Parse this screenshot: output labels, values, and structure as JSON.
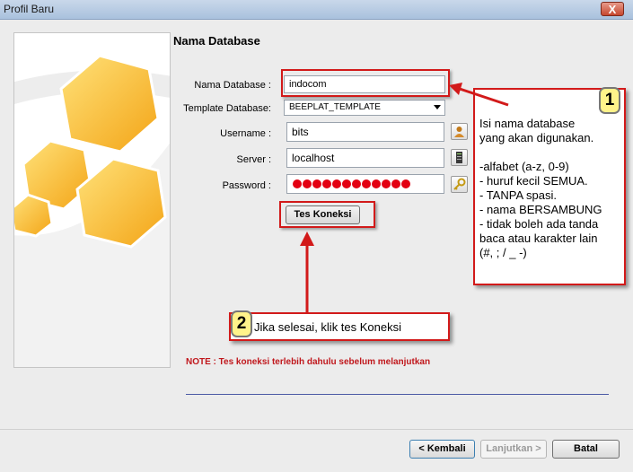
{
  "window": {
    "title": "Profil Baru",
    "close_glyph": "X"
  },
  "page": {
    "heading": "Nama Database"
  },
  "form": {
    "db_name": {
      "label": "Nama Database :",
      "value": "indocom"
    },
    "template": {
      "label": "Template Database:",
      "value": "BEEPLAT_TEMPLATE"
    },
    "username": {
      "label": "Username :",
      "value": "bits"
    },
    "server": {
      "label": "Server :",
      "value": "localhost"
    },
    "password": {
      "label": "Password :",
      "masked_length": 12
    },
    "test_button": "Tes Koneksi"
  },
  "note": "NOTE : Tes koneksi terlebih dahulu sebelum melanjutkan",
  "nav": {
    "back": "< Kembali",
    "next": "Lanjutkan >",
    "cancel": "Batal"
  },
  "callout1": {
    "number": "1",
    "lines": [
      "Isi nama database",
      "yang akan digunakan.",
      "",
      "-alfabet (a-z, 0-9)",
      "- huruf kecil SEMUA.",
      "- TANPA spasi.",
      "- nama BERSAMBUNG",
      "- tidak boleh ada tanda",
      "baca atau karakter lain",
      "(#, ; / _ -)"
    ]
  },
  "callout2": {
    "number": "2",
    "text": "Jika selesai, klik tes Koneksi"
  },
  "colors": {
    "annotation_red": "#d21a1a",
    "hexagon_yellow": "#fbc02d",
    "password_dot": "#e30012"
  }
}
